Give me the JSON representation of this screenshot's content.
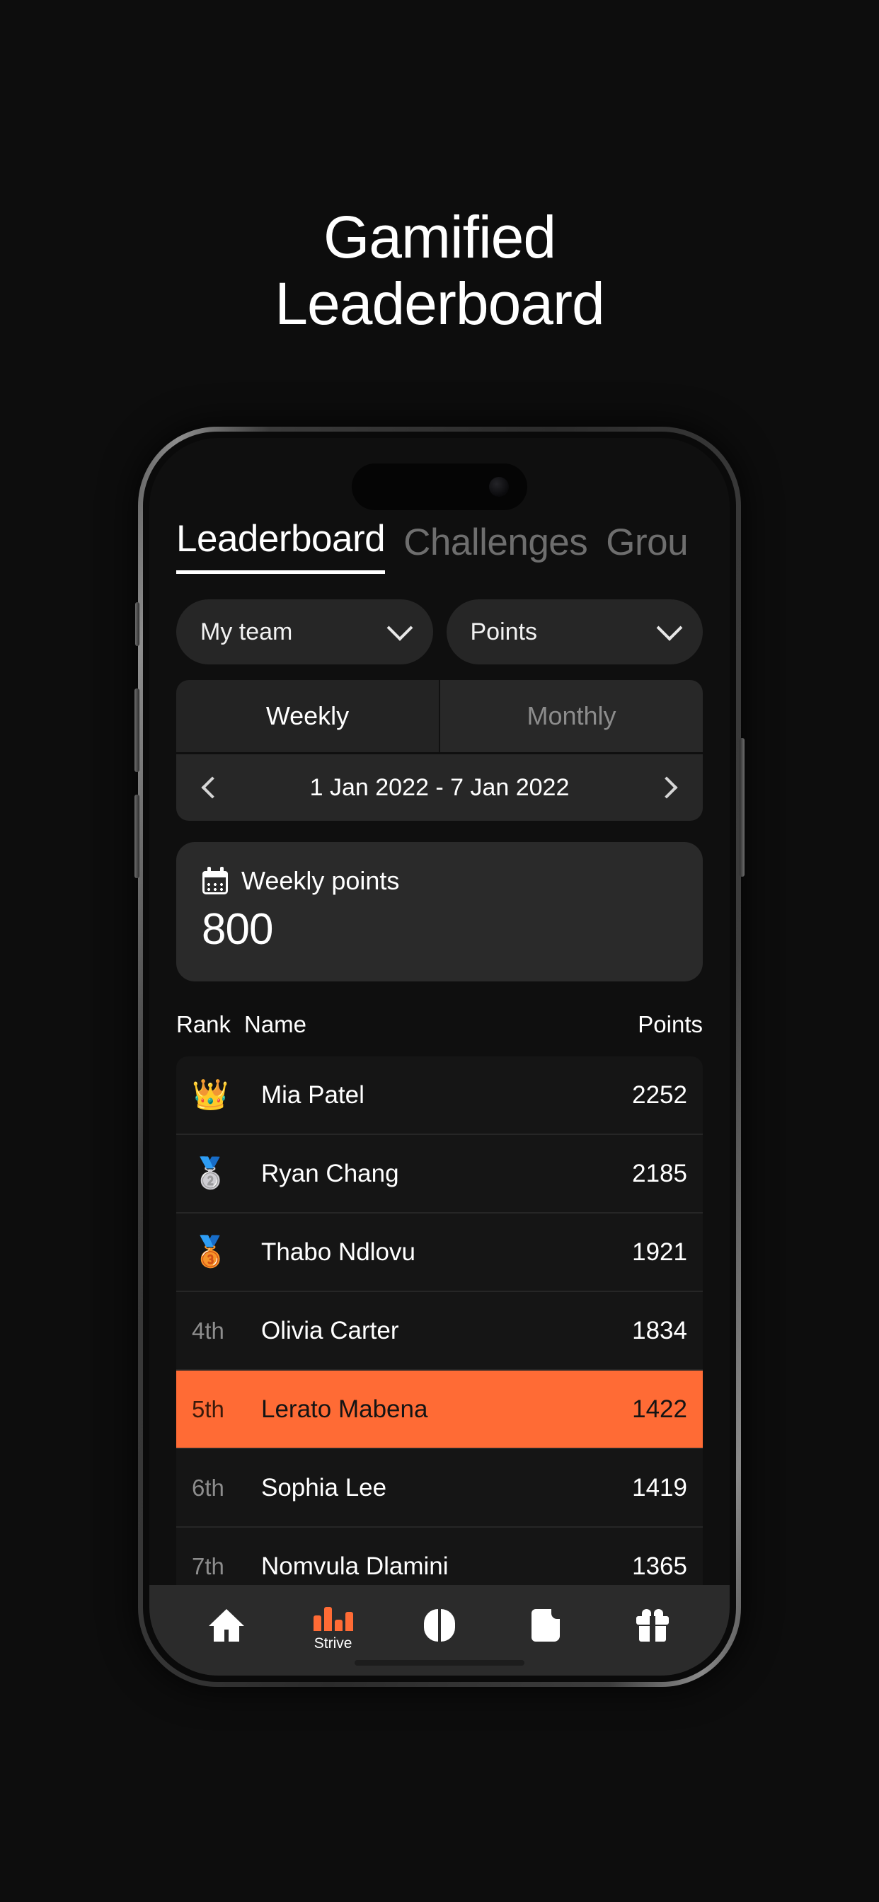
{
  "heading": {
    "line1": "Gamified",
    "line2": "Leaderboard"
  },
  "tabs": [
    {
      "label": "Leaderboard",
      "active": true
    },
    {
      "label": "Challenges",
      "active": false
    },
    {
      "label": "Grou",
      "active": false
    }
  ],
  "filters": [
    {
      "label": "My team",
      "icon": "chevron-down-icon"
    },
    {
      "label": "Points",
      "icon": "chevron-down-icon"
    }
  ],
  "period": {
    "options": [
      {
        "label": "Weekly",
        "active": true
      },
      {
        "label": "Monthly",
        "active": false
      }
    ],
    "date_range": "1 Jan 2022 - 7 Jan 2022",
    "prev_icon": "chevron-left-icon",
    "next_icon": "chevron-right-icon"
  },
  "points_card": {
    "icon": "calendar-icon",
    "label": "Weekly points",
    "value": "800"
  },
  "table": {
    "headers": {
      "rank": "Rank",
      "name": "Name",
      "points": "Points"
    },
    "rows": [
      {
        "rank": "",
        "medal": "👑",
        "name": "Mia Patel",
        "points": "2252",
        "highlight": false
      },
      {
        "rank": "",
        "medal": "🥈",
        "name": "Ryan Chang",
        "points": "2185",
        "highlight": false
      },
      {
        "rank": "",
        "medal": "🥉",
        "name": "Thabo Ndlovu",
        "points": "1921",
        "highlight": false
      },
      {
        "rank": "4th",
        "medal": "",
        "name": "Olivia Carter",
        "points": "1834",
        "highlight": false
      },
      {
        "rank": "5th",
        "medal": "",
        "name": "Lerato Mabena",
        "points": "1422",
        "highlight": true
      },
      {
        "rank": "6th",
        "medal": "",
        "name": "Sophia Lee",
        "points": "1419",
        "highlight": false
      },
      {
        "rank": "7th",
        "medal": "",
        "name": "Nomvula Dlamini",
        "points": "1365",
        "highlight": false
      }
    ]
  },
  "bottom_nav": [
    {
      "icon": "home-icon",
      "label": "",
      "active": false
    },
    {
      "icon": "bar-chart-icon",
      "label": "Strive",
      "active": true
    },
    {
      "icon": "brain-icon",
      "label": "",
      "active": false
    },
    {
      "icon": "book-icon",
      "label": "",
      "active": false
    },
    {
      "icon": "gift-icon",
      "label": "",
      "active": false
    }
  ],
  "colors": {
    "accent": "#FF6B35",
    "background": "#0d0d0d",
    "screen": "#0f0f0f",
    "card": "#2a2a2a",
    "row": "#151515",
    "text": "#ffffff",
    "muted": "#8d8d8d"
  }
}
